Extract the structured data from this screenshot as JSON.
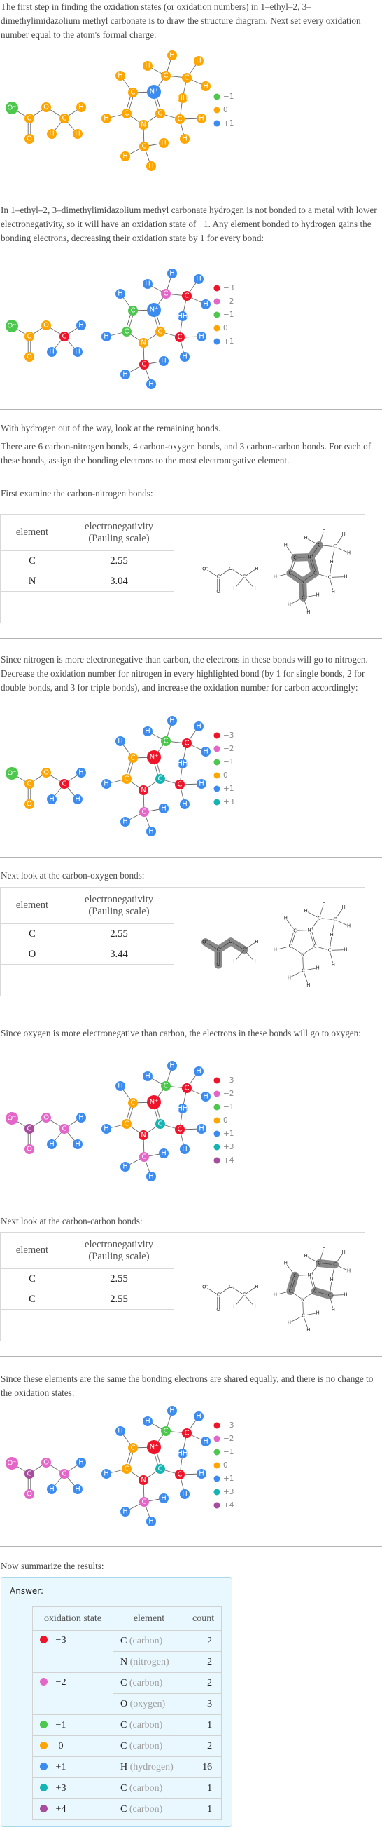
{
  "oxidation_colors": {
    "-3": "#f0142a",
    "-2": "#e466c8",
    "-1": "#4cc84c",
    "0": "#ffa500",
    "+1": "#3c8cf0",
    "+3": "#14b4b4",
    "+4": "#a84ca0"
  },
  "sections": {
    "intro": {
      "text": "The first step in finding the oxidation states (or oxidation numbers) in 1–ethyl–2, 3–dimethylimidazolium methyl carbonate is to draw the structure diagram. Next set every oxidation number equal to the atom's formal charge:"
    },
    "hydrogen": {
      "text": "In 1–ethyl–2, 3–dimethylimidazolium methyl carbonate hydrogen is not bonded to a metal with lower electronegativity, so it will have an oxidation state of +1. Any element bonded to hydrogen gains the bonding electrons, decreasing their oxidation state by 1 for every bond:"
    },
    "remaining": {
      "text1": "With hydrogen out of the way, look at the remaining bonds.",
      "text2": "There are 6 carbon-nitrogen bonds, 4 carbon-oxygen bonds, and 3 carbon-carbon bonds.  For each of these bonds, assign the bonding electrons to the most electronegative element.",
      "text3": "First examine the carbon-nitrogen bonds:"
    },
    "cn_result": {
      "text": "Since nitrogen is more electronegative than carbon, the electrons in these bonds will go to nitrogen. Decrease the oxidation number for nitrogen in every highlighted bond (by 1 for single bonds, 2 for double bonds, and 3 for triple bonds), and increase the oxidation number for carbon accordingly:"
    },
    "co_intro": {
      "text": "Next look at the carbon-oxygen bonds:"
    },
    "co_result": {
      "text": "Since oxygen is more electronegative than carbon, the electrons in these bonds will go to oxygen:"
    },
    "cc_intro": {
      "text": "Next look at the carbon-carbon bonds:"
    },
    "cc_result": {
      "text": "Since these elements are the same the bonding electrons are shared equally, and there is no change to the oxidation states:"
    },
    "summary": {
      "text": "Now summarize the results:"
    }
  },
  "en_tables": {
    "header_element": "element",
    "header_en_line1": "electronegativity",
    "header_en_line2": "(Pauling scale)",
    "cn": {
      "rows": [
        {
          "element": "C",
          "value": "2.55"
        },
        {
          "element": "N",
          "value": "3.04"
        }
      ]
    },
    "co": {
      "rows": [
        {
          "element": "C",
          "value": "2.55"
        },
        {
          "element": "O",
          "value": "3.44"
        }
      ]
    },
    "cc": {
      "rows": [
        {
          "element": "C",
          "value": "2.55"
        },
        {
          "element": "C",
          "value": "2.55"
        }
      ]
    }
  },
  "molecule": {
    "atoms": [
      "O⁻",
      "C",
      "O",
      "O",
      "C",
      "H",
      "H",
      "H",
      "C",
      "N⁺",
      "C",
      "C",
      "N",
      "H",
      "H",
      "C",
      "H",
      "H",
      "C",
      "H",
      "H",
      "HH",
      "C",
      "H",
      "H",
      "C",
      "H",
      "H",
      "H"
    ],
    "small_labels": [
      "O⁻",
      "C",
      "O",
      "O",
      "C",
      "H",
      "H",
      "H",
      "C",
      "N⁺",
      "C",
      "C",
      "N",
      "H",
      "H",
      "C",
      "H",
      "H",
      "C",
      "H",
      "H",
      "H",
      "C",
      "H",
      "H",
      "C",
      "H",
      "H",
      "H"
    ],
    "bonds_cn_highlight": "C4–N⁺, N⁺–CH2, N⁺=C2, C2–N, N–C5, N–CH3",
    "bonds_co_highlight": "O⁻–C, C=O, C–O, O–CH3",
    "bonds_cc_highlight": "C4=C5, CH2–CH3, C2–CH3"
  },
  "diagrams": [
    {
      "legend": [
        "-1",
        "0",
        "+1"
      ],
      "states": [
        "-1",
        "0",
        "0",
        "0",
        "0",
        "0",
        "0",
        "0",
        "0",
        "+1",
        "0",
        "0",
        "0",
        "0",
        "0",
        "0",
        "0",
        "0",
        "0",
        "0",
        "0",
        "0",
        "0",
        "0",
        "0",
        "0",
        "0",
        "0",
        "0"
      ]
    },
    {
      "legend": [
        "-3",
        "-2",
        "-1",
        "0",
        "+1"
      ],
      "states": [
        "-1",
        "0",
        "0",
        "0",
        "-3",
        "+1",
        "+1",
        "+1",
        "-1",
        "+1",
        "-1",
        "0",
        "0",
        "+1",
        "+1",
        "-2",
        "+1",
        "+1",
        "-3",
        "+1",
        "+1",
        "+1",
        "-3",
        "+1",
        "+1",
        "-3",
        "+1",
        "+1",
        "+1"
      ]
    },
    {
      "legend": [
        "-3",
        "-2",
        "-1",
        "0",
        "+1",
        "+3"
      ],
      "states": [
        "-1",
        "0",
        "0",
        "0",
        "-3",
        "+1",
        "+1",
        "+1",
        "0",
        "-3",
        "0",
        "+3",
        "-3",
        "+1",
        "+1",
        "-1",
        "+1",
        "+1",
        "-3",
        "+1",
        "+1",
        "+1",
        "-3",
        "+1",
        "+1",
        "-2",
        "+1",
        "+1",
        "+1"
      ]
    },
    {
      "legend": [
        "-3",
        "-2",
        "-1",
        "0",
        "+1",
        "+3",
        "+4"
      ],
      "states": [
        "-2",
        "+4",
        "-2",
        "-2",
        "-2",
        "+1",
        "+1",
        "+1",
        "0",
        "-3",
        "0",
        "+3",
        "-3",
        "+1",
        "+1",
        "-1",
        "+1",
        "+1",
        "-3",
        "+1",
        "+1",
        "+1",
        "-3",
        "+1",
        "+1",
        "-2",
        "+1",
        "+1",
        "+1"
      ]
    },
    {
      "legend": [
        "-3",
        "-2",
        "-1",
        "0",
        "+1",
        "+3",
        "+4"
      ],
      "states": [
        "-2",
        "+4",
        "-2",
        "-2",
        "-2",
        "+1",
        "+1",
        "+1",
        "0",
        "-3",
        "0",
        "+3",
        "-3",
        "+1",
        "+1",
        "-1",
        "+1",
        "+1",
        "-3",
        "+1",
        "+1",
        "+1",
        "-3",
        "+1",
        "+1",
        "-2",
        "+1",
        "+1",
        "+1"
      ]
    }
  ],
  "answer": {
    "label": "Answer:",
    "headers": [
      "oxidation state",
      "element",
      "count"
    ],
    "groups": [
      {
        "state": "−3",
        "key": "-3",
        "rows": [
          {
            "symbol": "C",
            "name": "(carbon)",
            "count": "2"
          },
          {
            "symbol": "N",
            "name": "(nitrogen)",
            "count": "2"
          }
        ]
      },
      {
        "state": "−2",
        "key": "-2",
        "rows": [
          {
            "symbol": "C",
            "name": "(carbon)",
            "count": "2"
          },
          {
            "symbol": "O",
            "name": "(oxygen)",
            "count": "3"
          }
        ]
      },
      {
        "state": "−1",
        "key": "-1",
        "rows": [
          {
            "symbol": "C",
            "name": "(carbon)",
            "count": "1"
          }
        ]
      },
      {
        "state": "0",
        "key": "0",
        "rows": [
          {
            "symbol": "C",
            "name": "(carbon)",
            "count": "2"
          }
        ]
      },
      {
        "state": "+1",
        "key": "+1",
        "rows": [
          {
            "symbol": "H",
            "name": "(hydrogen)",
            "count": "16"
          }
        ]
      },
      {
        "state": "+3",
        "key": "+3",
        "rows": [
          {
            "symbol": "C",
            "name": "(carbon)",
            "count": "1"
          }
        ]
      },
      {
        "state": "+4",
        "key": "+4",
        "rows": [
          {
            "symbol": "C",
            "name": "(carbon)",
            "count": "1"
          }
        ]
      }
    ]
  }
}
